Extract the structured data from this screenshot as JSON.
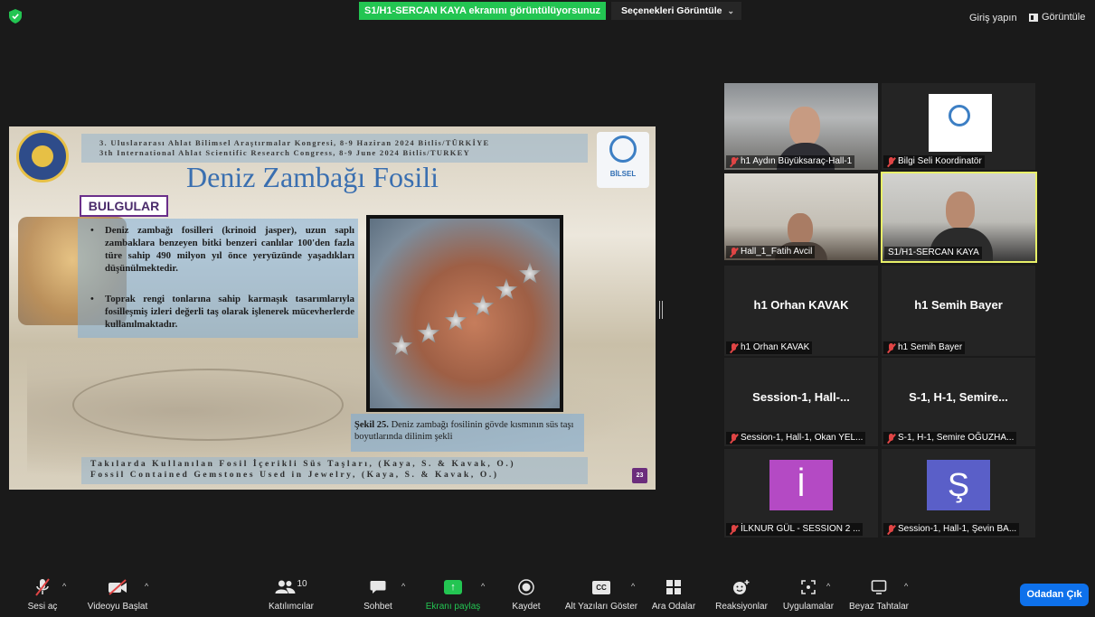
{
  "top_bar": {
    "share_banner": "S1/H1-SERCAN KAYA ekranını görüntülüyorsunuz",
    "options_label": "Seçenekleri Görüntüle",
    "signin_label": "Giriş yapın",
    "view_label": "Görüntüle"
  },
  "slide": {
    "conference_tr": "3. Uluslararası Ahlat Bilimsel Araştırmalar Kongresi, 8-9 Haziran 2024 Bitlis/TÜRKİYE",
    "conference_en": "3th International Ahlat Scientific Research Congress, 8-9 June 2024 Bitlis/TURKEY",
    "title": "Deniz Zambağı Fosili",
    "section_label": "BULGULAR",
    "bullets": [
      "Deniz zambağı fosilleri (krinoid jasper), uzun saplı zambaklara benzeyen bitki benzeri canlılar 100'den fazla türe sahip 490 milyon yıl önce yeryüzünde yaşadıkları düşünülmektedir.",
      "Toprak rengi tonlarına sahip karmaşık tasarımlarıyla fosilleşmiş izleri değerli taş olarak işlenerek mücevherlerde kullanılmaktadır."
    ],
    "caption_bold": "Şekil 25.",
    "caption_text": " Deniz zambağı fosilinin gövde kısmının süs taşı boyutlarında dilinim şekli",
    "footer_tr": "Takılarda Kullanılan Fosil İçerikli Süs Taşları, (Kaya, S. & Kavak, O.)",
    "footer_en": "Fossil Contained Gemstones Used in Jewelry, (Kaya, S. & Kavak, O.)",
    "page_number": "23",
    "bilsel_logo_text": "BİLSEL"
  },
  "participants": [
    {
      "label": "h1 Aydın Büyüksaraç-Hall-1",
      "big": "",
      "muted": true
    },
    {
      "label": "Bilgi Seli Koordinatör",
      "big": "",
      "muted": true
    },
    {
      "label": "Hall_1_Fatih Avcil",
      "big": "",
      "muted": true
    },
    {
      "label": "S1/H1-SERCAN KAYA",
      "big": "",
      "muted": false
    },
    {
      "label": "h1 Orhan KAVAK",
      "big": "h1 Orhan KAVAK",
      "muted": true
    },
    {
      "label": "h1 Semih Bayer",
      "big": "h1 Semih Bayer",
      "muted": true
    },
    {
      "label": "Session-1, Hall-1, Okan YEL...",
      "big": "Session-1,  Hall-...",
      "muted": true
    },
    {
      "label": "S-1, H-1, Semire OĞUZHA...",
      "big": "S-1,  H-1,  Semire...",
      "muted": true
    },
    {
      "label": "İLKNUR GÜL - SESSION 2 ...",
      "big": "",
      "avatar": "İ",
      "avatar_color": "#b44ac4",
      "muted": true
    },
    {
      "label": "Session-1, Hall-1, Şevin BA...",
      "big": "",
      "avatar": "Ş",
      "avatar_color": "#5a5fc8",
      "muted": true
    }
  ],
  "toolbar": {
    "mute_label": "Sesi aç",
    "video_label": "Videoyu Başlat",
    "participants_label": "Katılımcılar",
    "participants_count": "10",
    "chat_label": "Sohbet",
    "share_label": "Ekranı paylaş",
    "record_label": "Kaydet",
    "cc_label": "Alt Yazıları Göster",
    "breakout_label": "Ara Odalar",
    "reactions_label": "Reaksiyonlar",
    "apps_label": "Uygulamalar",
    "whiteboard_label": "Beyaz Tahtalar",
    "leave_label": "Odadan Çık"
  },
  "colors": {
    "share_green": "#23c552",
    "leave_blue": "#0e71eb",
    "active_speaker": "#e8f068",
    "muted_red": "#e04545"
  }
}
